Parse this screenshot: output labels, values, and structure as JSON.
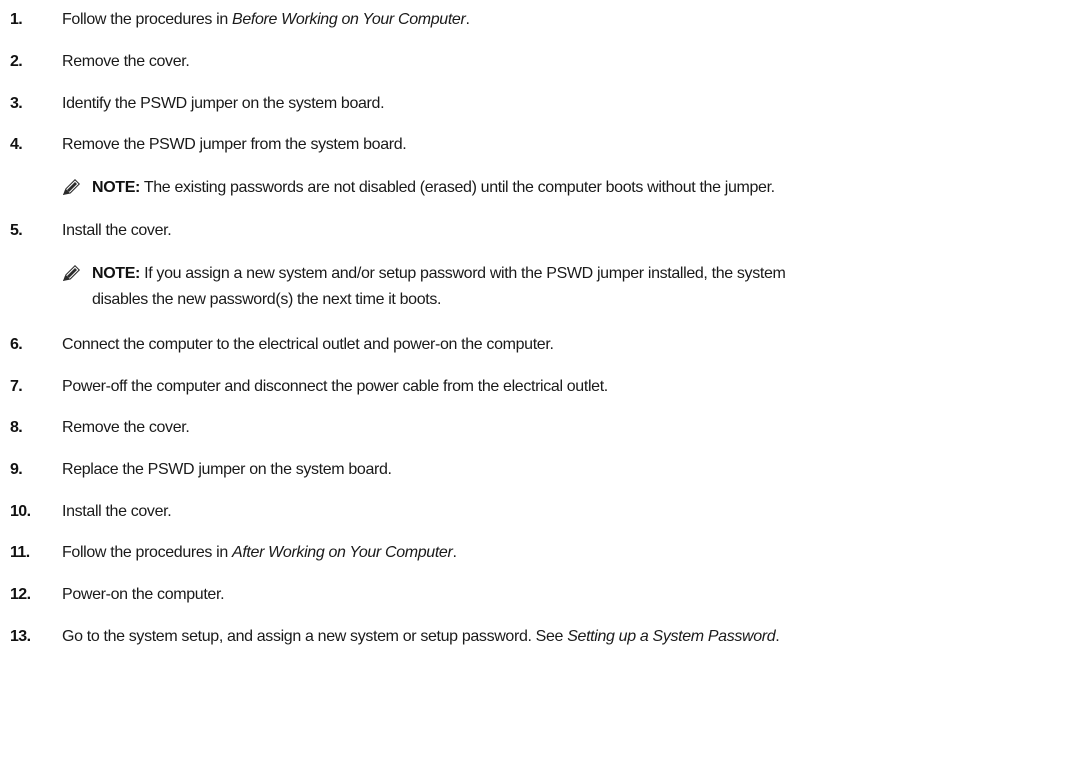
{
  "steps": [
    {
      "num": "1.",
      "pre": "Follow the procedures in ",
      "em": "Before Working on Your Computer",
      "post": "."
    },
    {
      "num": "2.",
      "text": "Remove the cover."
    },
    {
      "num": "3.",
      "text": "Identify the PSWD jumper on the system board."
    },
    {
      "num": "4.",
      "text": "Remove the PSWD jumper from the system board."
    },
    {
      "num": "5.",
      "text": "Install the cover."
    },
    {
      "num": "6.",
      "text": "Connect the computer to the electrical outlet and power-on the computer."
    },
    {
      "num": "7.",
      "text": "Power-off the computer and disconnect the power cable from the electrical outlet."
    },
    {
      "num": "8.",
      "text": "Remove the cover."
    },
    {
      "num": "9.",
      "text": "Replace the PSWD jumper on the system board."
    },
    {
      "num": "10.",
      "text": "Install the cover."
    },
    {
      "num": "11.",
      "pre": "Follow the procedures in ",
      "em": "After Working on Your Computer",
      "post": "."
    },
    {
      "num": "12.",
      "text": "Power-on the computer."
    },
    {
      "num": "13.",
      "pre": "Go to the system setup, and assign a new system or setup password. See ",
      "em": "Setting up a System Password",
      "post": "."
    }
  ],
  "notes": [
    {
      "label": "NOTE:",
      "text": " The existing passwords are not disabled (erased) until the computer boots without the jumper."
    },
    {
      "label": "NOTE:",
      "line1": " If you assign a new system and/or setup password with the PSWD jumper installed, the system",
      "line2": "disables the new password(s) the next time it boots."
    }
  ],
  "icons": {
    "note": "pencil-note-icon"
  }
}
